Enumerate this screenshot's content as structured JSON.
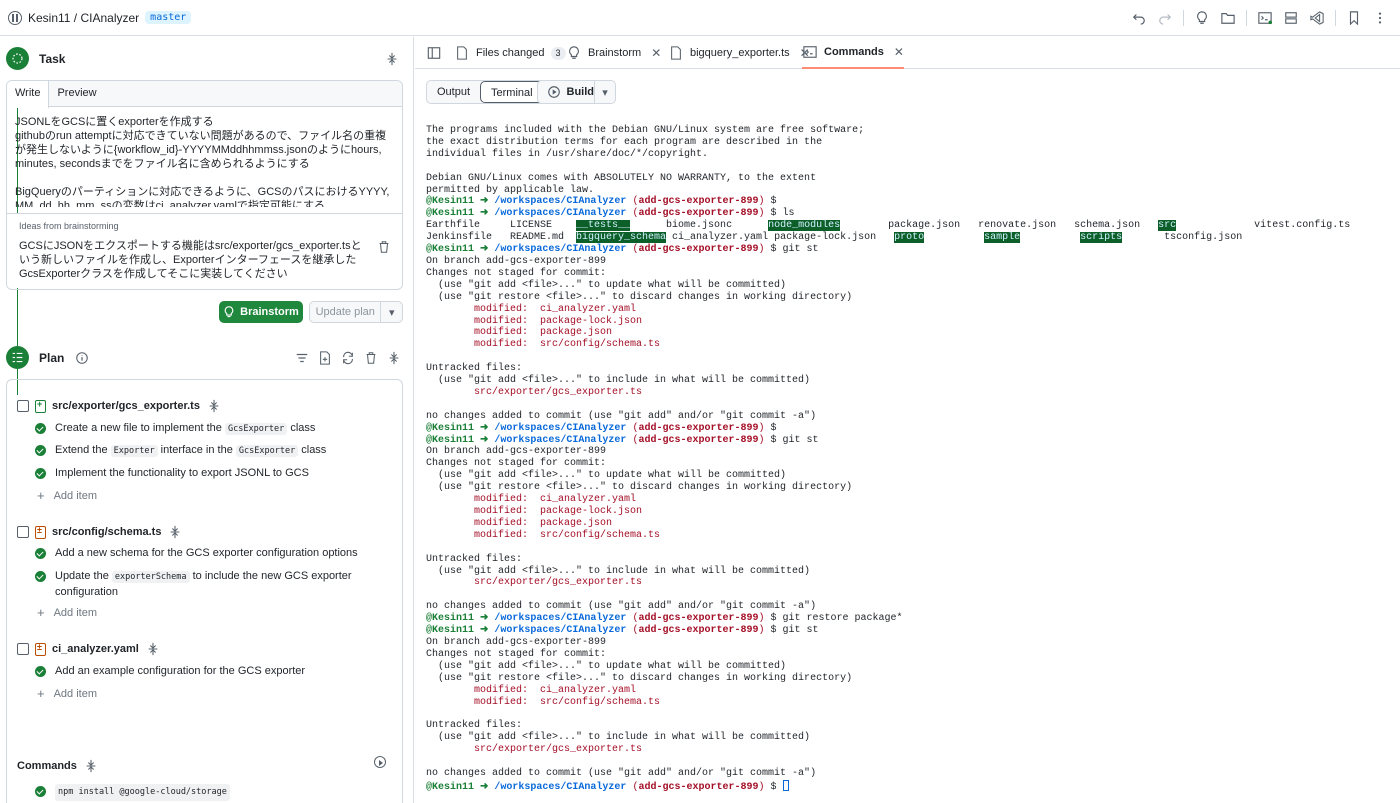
{
  "header": {
    "repo": "Kesin11 / CIAnalyzer",
    "branch": "master"
  },
  "task": {
    "title": "Task",
    "tabs": [
      "Write",
      "Preview"
    ],
    "text": "JSONLをGCSに置くexporterを作成する\ngithubのrun attemptに対応できていない問題があるので、ファイル名の重複が発生しないように{workflow_id}-YYYYMMddhhmmss.jsonのようにhours, minutes, secondsまでをファイル名に含められるようにする\n\nBigQueryのパーティションに対応できるように、GCSのパスにおけるYYYY, MM, dd, hh, mm, ssの変数はci_analyzer.yamlで指定可能にする",
    "ideas_label": "Ideas from brainstorming",
    "ideas_text": "GCSにJSONをエクスポートする機能はsrc/exporter/gcs_exporter.tsという新しいファイルを作成し、Exporterインターフェースを継承したGcsExporterクラスを作成してそこに実装してください",
    "brainstorm_button": "Brainstorm",
    "update_plan_button": "Update plan"
  },
  "plan": {
    "title": "Plan",
    "files": [
      {
        "path": "src/exporter/gcs_exporter.ts",
        "items": [
          {
            "pre": "Create a new file to implement the ",
            "code": "GcsExporter",
            "post": " class"
          },
          {
            "pre": "Extend the ",
            "code": "Exporter",
            "mid": " interface in the ",
            "code2": "GcsExporter",
            "post": " class"
          },
          {
            "pre": "Implement the functionality to export JSONL to GCS"
          }
        ]
      },
      {
        "path": "src/config/schema.ts",
        "items": [
          {
            "pre": "Add a new schema for the GCS exporter configuration options"
          },
          {
            "pre": "Update the ",
            "code": "exporterSchema",
            "post": " to include the new GCS exporter configuration"
          }
        ]
      },
      {
        "path": "ci_analyzer.yaml",
        "items": [
          {
            "pre": "Add an example configuration for the GCS exporter"
          }
        ]
      }
    ],
    "add_item_label": "Add item",
    "commands_title": "Commands",
    "command": "npm install @google-cloud/storage"
  },
  "right": {
    "tabs": {
      "files_changed": "Files changed",
      "files_changed_count": "3",
      "brainstorm": "Brainstorm",
      "bigquery": "bigquery_exporter.ts",
      "commands": "Commands"
    },
    "output_label": "Output",
    "terminal_label": "Terminal",
    "build_label": "Build"
  },
  "terminal": {
    "user": "@Kesin11",
    "path": "/workspaces/CIAnalyzer",
    "branch": "(add-gcs-exporter-899)",
    "motd": "The programs included with the Debian GNU/Linux system are free software;\nthe exact distribution terms for each program are described in the\nindividual files in /usr/share/doc/*/copyright.\n\nDebian GNU/Linux comes with ABSOLUTELY NO WARRANTY, to the extent\npermitted by applicable law.",
    "ls_files": [
      "Earthfile",
      "LICENSE",
      "__tests__",
      "biome.jsonc",
      "node_modules",
      "package.json",
      "renovate.json",
      "schema.json",
      "src",
      "vitest.config.ts",
      "Jenkinsfile",
      "README.md",
      "bigquery_schema",
      "ci_analyzer.yaml",
      "package-lock.json",
      "proto",
      "sample",
      "scripts",
      "tsconfig.json"
    ],
    "cmd_ls": "ls",
    "cmd_git_st": "git st",
    "cmd_restore": "git restore package*",
    "on_branch": "On branch add-gcs-exporter-899",
    "not_staged": "Changes not staged for commit:",
    "hint_add": "  (use \"git add <file>...\" to update what will be committed)",
    "hint_restore": "  (use \"git restore <file>...\" to discard changes in working directory)",
    "modified_label": "modified:",
    "modified_files_4": [
      "ci_analyzer.yaml",
      "package-lock.json",
      "package.json",
      "src/config/schema.ts"
    ],
    "modified_files_2": [
      "ci_analyzer.yaml",
      "src/config/schema.ts"
    ],
    "untracked": "Untracked files:",
    "hint_untracked": "  (use \"git add <file>...\" to include in what will be committed)",
    "untracked_file": "src/exporter/gcs_exporter.ts",
    "no_changes": "no changes added to commit (use \"git add\" and/or \"git commit -a\")"
  }
}
